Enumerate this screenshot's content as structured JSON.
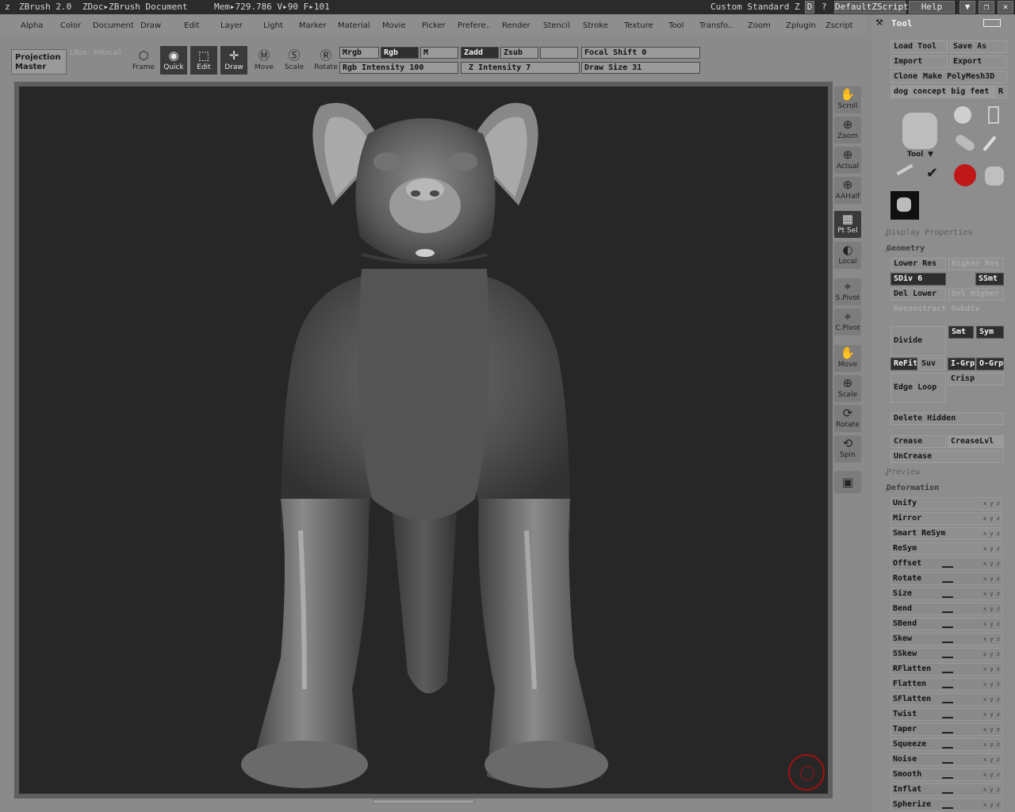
{
  "titlebar": {
    "app": "ZBrush 2.0",
    "doc": "ZDoc▸ZBrush Document",
    "mem": "Mem▸729.786 V▸90 F▸101",
    "layout": "Custom Standard Z",
    "d_btn": "D",
    "help_q": "?",
    "script": "DefaultZScript",
    "help": "Help"
  },
  "menu": [
    "Alpha",
    "Color",
    "Document",
    "Draw",
    "Edit",
    "Layer",
    "Light",
    "Marker",
    "Material",
    "Movie",
    "Picker",
    "Prefere..",
    "Render",
    "Stencil",
    "Stroke",
    "Texture",
    "Tool",
    "Transfo..",
    "Zoom",
    "Zplugin",
    "Zscript"
  ],
  "shelf": {
    "projection_master": "Projection Master",
    "buttons": [
      {
        "label": "Frame",
        "icon": "frame-icon"
      },
      {
        "label": "Quick",
        "icon": "quick-icon"
      },
      {
        "label": "Edit",
        "icon": "edit-icon"
      },
      {
        "label": "Draw",
        "icon": "draw-icon"
      },
      {
        "label": "Move",
        "icon": "move-icon"
      },
      {
        "label": "Scale",
        "icon": "scale-icon"
      },
      {
        "label": "Rotate",
        "icon": "rotate-icon"
      }
    ],
    "mrgb": "Mrgb",
    "rgb": "Rgb",
    "m": "M",
    "zadd": "Zadd",
    "zsub": "Zsub",
    "rgb_intensity_label": "Rgb Intensity",
    "rgb_intensity": "100",
    "z_intensity_label": "Z Intensity",
    "z_intensity": "7",
    "focal_shift_label": "Focal Shift",
    "focal_shift": "0",
    "draw_size_label": "Draw Size",
    "draw_size": "31"
  },
  "righttools": [
    {
      "label": "Scroll",
      "icon": "hand-icon"
    },
    {
      "label": "Zoom",
      "icon": "zoom-icon"
    },
    {
      "label": "Actual",
      "icon": "actual-icon"
    },
    {
      "label": "AAHalf",
      "icon": "aahalf-icon"
    },
    {
      "label": "Pt Sel",
      "icon": "ptsel-icon"
    },
    {
      "label": "Local",
      "icon": "local-icon"
    },
    {
      "label": "S.Pivot",
      "icon": "spivot-icon"
    },
    {
      "label": "C.Pivot",
      "icon": "cpivot-icon"
    },
    {
      "label": "Move",
      "icon": "move-icon"
    },
    {
      "label": "Scale",
      "icon": "scale-icon"
    },
    {
      "label": "Rotate",
      "icon": "rotate-icon"
    },
    {
      "label": "Spin",
      "icon": "spin-icon"
    }
  ],
  "panel": {
    "title": "Tool",
    "load_tool": "Load Tool",
    "save_as": "Save As",
    "import": "Import",
    "export": "Export",
    "clone": "Clone",
    "make_polymesh": "Make PolyMesh3D",
    "tool_name": "dog concept big feet",
    "r_btn": "R",
    "tool_label": "Tool",
    "display_properties": "Display Properties",
    "geometry": "Geometry",
    "lower_res": "Lower Res",
    "higher_res": "Higher Res",
    "sdiv_label": "SDiv",
    "sdiv": "6",
    "ssmt": "SSmt",
    "del_lower": "Del Lower",
    "del_higher": "Del Higher",
    "reconstruct": "Reconstruct Subdiv",
    "divide": "Divide",
    "smt": "Smt",
    "sym": "Sym",
    "refit": "ReFit",
    "suv": "Suv",
    "igrp": "I-Grp",
    "ogrp": "O-Grp",
    "edge_loop": "Edge Loop",
    "crisp": "Crisp",
    "delete_hidden": "Delete Hidden",
    "crease": "Crease",
    "creaselvl": "CreaseLvl",
    "uncrease": "UnCrease",
    "preview": "Preview",
    "deformation": "Deformation",
    "def_items": [
      "Unify",
      "Mirror",
      "Smart ReSym",
      "ReSym",
      "Offset",
      "Rotate",
      "Size",
      "Bend",
      "SBend",
      "Skew",
      "SSkew",
      "RFlatten",
      "Flatten",
      "SFlatten",
      "Twist",
      "Taper",
      "Squeeze",
      "Noise",
      "Smooth",
      "Inflat",
      "Spherize"
    ]
  },
  "colors": {
    "accent_red": "#c01818",
    "canvas_bg": "#272727"
  }
}
